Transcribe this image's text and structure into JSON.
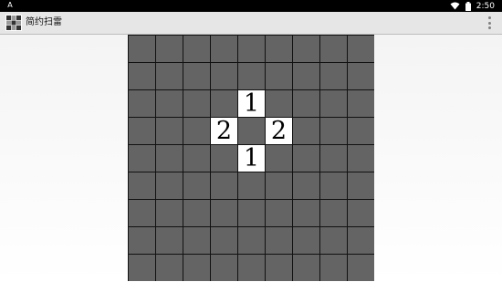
{
  "status_bar": {
    "left_icon": "A",
    "time": "2:50",
    "icons": [
      "wifi-icon",
      "battery-icon"
    ]
  },
  "app_bar": {
    "title": "简约扫雷",
    "icon": "minesweeper-app-icon",
    "menu_icon": "overflow-menu-icon"
  },
  "colors": {
    "hidden_cell": "#646464",
    "revealed_cell": "#ffffff",
    "grid_line": "#111111",
    "number_text": "#000000"
  },
  "board": {
    "rows": 9,
    "cols": 9,
    "cells": [
      [
        "",
        "",
        "",
        "",
        "",
        "",
        "",
        "",
        ""
      ],
      [
        "",
        "",
        "",
        "",
        "",
        "",
        "",
        "",
        ""
      ],
      [
        "",
        "",
        "",
        "",
        "1",
        "",
        "",
        "",
        ""
      ],
      [
        "",
        "",
        "",
        "2",
        "",
        "2",
        "",
        "",
        ""
      ],
      [
        "",
        "",
        "",
        "",
        "1",
        "",
        "",
        "",
        ""
      ],
      [
        "",
        "",
        "",
        "",
        "",
        "",
        "",
        "",
        ""
      ],
      [
        "",
        "",
        "",
        "",
        "",
        "",
        "",
        "",
        ""
      ],
      [
        "",
        "",
        "",
        "",
        "",
        "",
        "",
        "",
        ""
      ],
      [
        "",
        "",
        "",
        "",
        "",
        "",
        "",
        "",
        ""
      ]
    ],
    "revealed": [
      [
        false,
        false,
        false,
        false,
        false,
        false,
        false,
        false,
        false
      ],
      [
        false,
        false,
        false,
        false,
        false,
        false,
        false,
        false,
        false
      ],
      [
        false,
        false,
        false,
        false,
        true,
        false,
        false,
        false,
        false
      ],
      [
        false,
        false,
        false,
        true,
        false,
        true,
        false,
        false,
        false
      ],
      [
        false,
        false,
        false,
        false,
        true,
        false,
        false,
        false,
        false
      ],
      [
        false,
        false,
        false,
        false,
        false,
        false,
        false,
        false,
        false
      ],
      [
        false,
        false,
        false,
        false,
        false,
        false,
        false,
        false,
        false
      ],
      [
        false,
        false,
        false,
        false,
        false,
        false,
        false,
        false,
        false
      ],
      [
        false,
        false,
        false,
        false,
        false,
        false,
        false,
        false,
        false
      ]
    ]
  }
}
